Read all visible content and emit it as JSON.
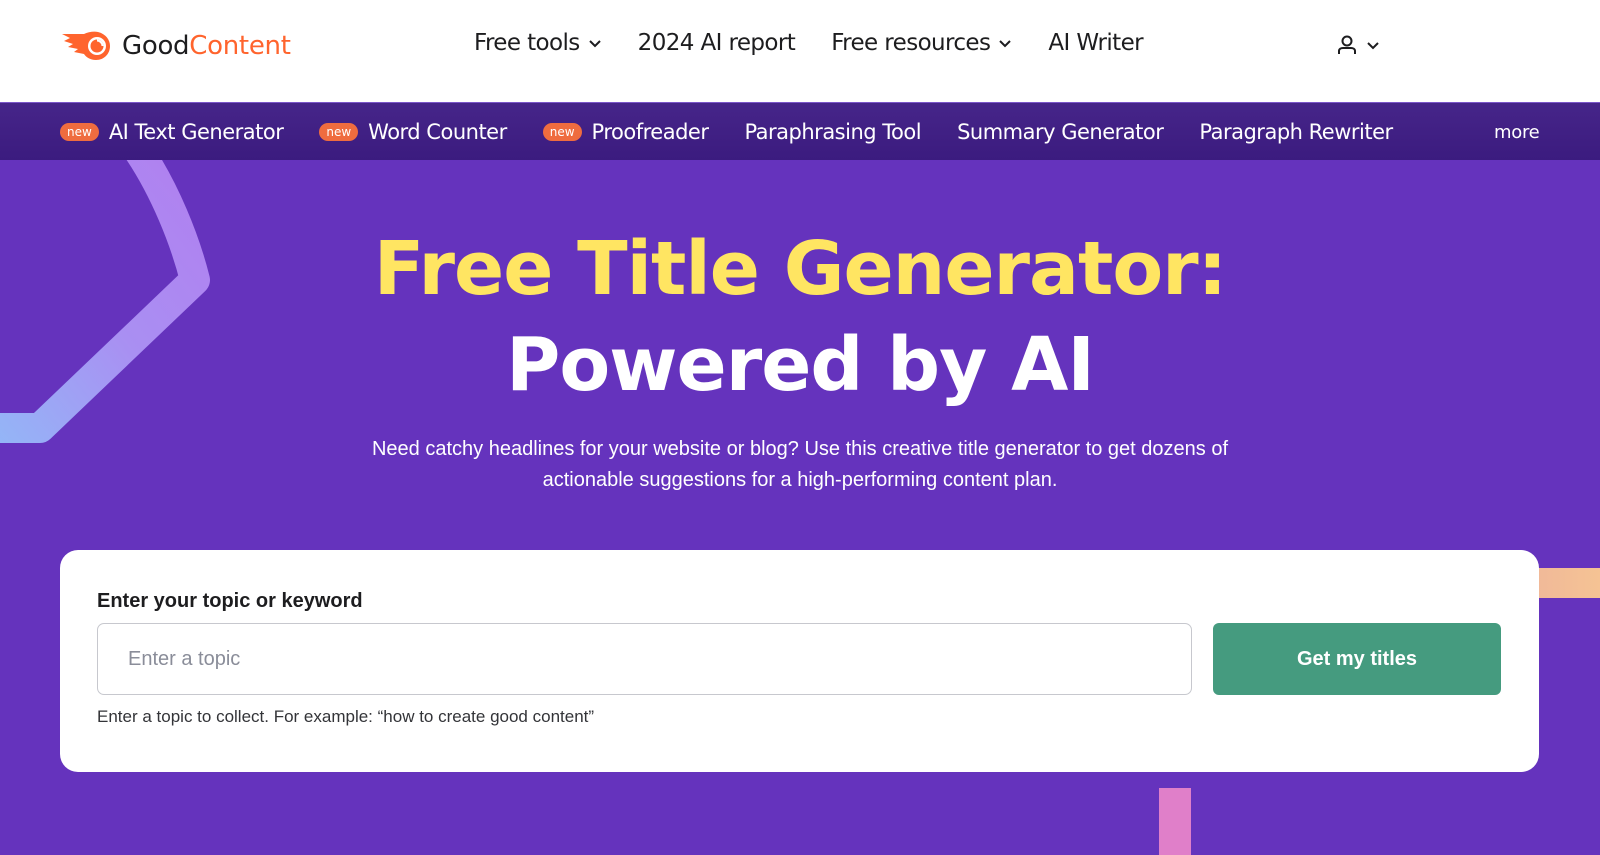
{
  "header": {
    "logo": {
      "part1": "Good",
      "part2": "Content",
      "icon": "fire-ball-icon"
    },
    "nav": [
      {
        "label": "Free tools",
        "has_dropdown": true
      },
      {
        "label": "2024 AI report",
        "has_dropdown": false
      },
      {
        "label": "Free resources",
        "has_dropdown": true
      },
      {
        "label": "AI Writer",
        "has_dropdown": false
      }
    ],
    "user_menu": {
      "icon": "user-icon",
      "has_dropdown": true
    }
  },
  "subnav": {
    "items": [
      {
        "label": "AI Text Generator",
        "badge": "new"
      },
      {
        "label": "Word Counter",
        "badge": "new"
      },
      {
        "label": "Proofreader",
        "badge": "new"
      },
      {
        "label": "Paraphrasing Tool"
      },
      {
        "label": "Summary Generator"
      },
      {
        "label": "Paragraph Rewriter"
      }
    ],
    "more_label": "more"
  },
  "hero": {
    "title_line1": "Free Title Generator:",
    "title_line2": "Powered by AI",
    "subtitle": "Need catchy headlines for your website or blog? Use this creative title generator to get dozens of actionable suggestions for a high-performing content plan."
  },
  "form": {
    "label": "Enter your topic or keyword",
    "input_value": "",
    "input_placeholder": "Enter a topic",
    "submit_label": "Get my titles",
    "hint": "Enter a topic to collect. For example: “how to create good content”"
  },
  "colors": {
    "brand_orange": "#ff642d",
    "hero_purple": "#6533bd",
    "subnav_purple": "#3b1b7f",
    "title_yellow": "#ffe562",
    "button_green": "#459b7f",
    "badge_orange": "#ef6c3f"
  }
}
